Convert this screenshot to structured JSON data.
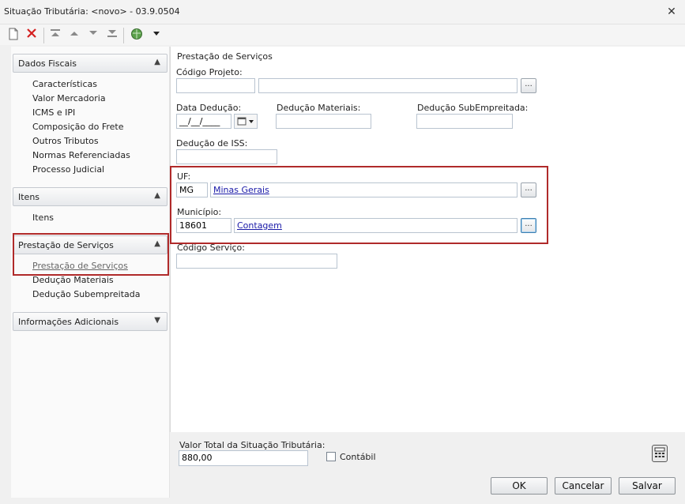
{
  "window": {
    "title": "Situação Tributária: <novo> - 03.9.0504",
    "close_glyph": "✕"
  },
  "toolbar": {
    "icons": [
      "new-icon",
      "delete-icon",
      "first-icon",
      "prev-icon",
      "next-icon",
      "last-icon",
      "globe-icon",
      "dropdown-icon"
    ]
  },
  "sidebar": {
    "groups": [
      {
        "label": "Dados Fiscais",
        "expanded": true,
        "items": [
          "Características",
          "Valor Mercadoria",
          "ICMS e IPI",
          "Composição do Frete",
          "Outros Tributos",
          "Normas Referenciadas",
          "Processo Judicial"
        ]
      },
      {
        "label": "Itens",
        "expanded": true,
        "items": [
          "Itens"
        ]
      },
      {
        "label": "Prestação de Serviços",
        "expanded": true,
        "items": [
          "Prestação de Serviços",
          "Dedução Materiais",
          "Dedução Subempreitada"
        ]
      },
      {
        "label": "Informações Adicionais",
        "expanded": false,
        "items": []
      }
    ]
  },
  "form": {
    "section_title": "Prestação de Serviços",
    "codigo_projeto": {
      "label": "Código Projeto:",
      "code": "",
      "desc": ""
    },
    "data_deducao": {
      "label": "Data Dedução:",
      "value": "__/__/____"
    },
    "deducao_materiais": {
      "label": "Dedução Materiais:",
      "value": ""
    },
    "deducao_subempreitada": {
      "label": "Dedução SubEmpreitada:",
      "value": ""
    },
    "deducao_iss": {
      "label": "Dedução de ISS:",
      "value": ""
    },
    "uf": {
      "label": "UF:",
      "code": "MG",
      "name": "Minas Gerais"
    },
    "municipio": {
      "label": "Município:",
      "code": "18601",
      "name": "Contagem"
    },
    "codigo_servico": {
      "label": "Código Serviço:",
      "value": ""
    },
    "lookup_glyph": "..."
  },
  "footer": {
    "total_label": "Valor Total da Situação Tributária:",
    "total_value": "880,00",
    "contabil_label": "Contábil",
    "contabil_checked": false,
    "ok_label": "OK",
    "cancel_label": "Cancelar",
    "save_label": "Salvar"
  },
  "colors": {
    "highlight_border": "#b02a2a",
    "link": "#1a1aa8"
  }
}
